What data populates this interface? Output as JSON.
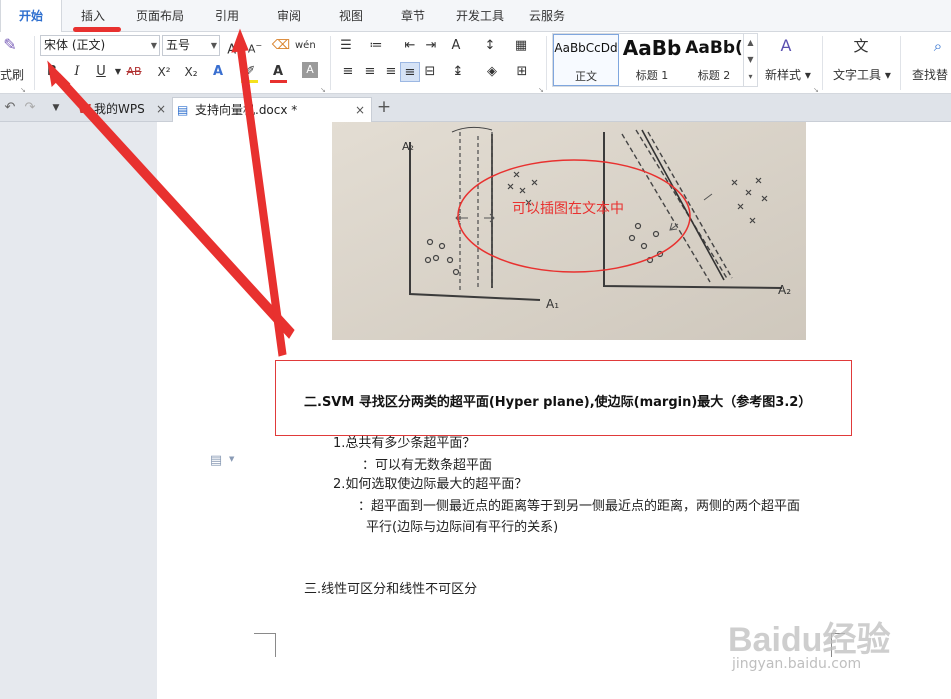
{
  "menu": {
    "tabs": [
      "开始",
      "插入",
      "页面布局",
      "引用",
      "审阅",
      "视图",
      "章节",
      "开发工具",
      "云服务"
    ],
    "active": "开始"
  },
  "ribbon": {
    "format_painter_label": "式刷",
    "font_name": "宋体 (正文)",
    "font_size": "五号",
    "bold": "B",
    "italic": "I",
    "underline": "U",
    "strikethrough": "AB",
    "superscript": "X²",
    "subscript": "X₂",
    "styles": [
      {
        "sample": "AaBbCcDd",
        "label": "正文"
      },
      {
        "sample": "AaBb",
        "label": "标题 1"
      },
      {
        "sample": "AaBb(",
        "label": "标题 2"
      }
    ],
    "new_style_label": "新样式",
    "text_tools_label": "文字工具",
    "find_replace_label": "查找替"
  },
  "doc_tabs": {
    "tab1": "我的WPS",
    "tab2": "支持向量机.docx *"
  },
  "document": {
    "image_caption": "可以插图在文本中",
    "heading": "二.SVM 寻找区分两类的超平面(Hyper plane),使边际(margin)最大（参考图3.2）",
    "q1": "1.总共有多少条超平面？",
    "a1": "：可以有无数条超平面",
    "q2": "2.如何选取使边际最大的超平面？",
    "a2_line1": "：超平面到一侧最近点的距离等于到另一侧最近点的距离，两侧的两个超平面",
    "a2_line2": "平行(边际与边际间有平行的关系)",
    "section3": "三.线性可区分和线性不可区分"
  },
  "watermark": {
    "brand": "Baidu经验",
    "url": "jingyan.baidu.com"
  },
  "colors": {
    "annotation_red": "#e8312f",
    "active_tab_blue": "#2e6fcf"
  }
}
